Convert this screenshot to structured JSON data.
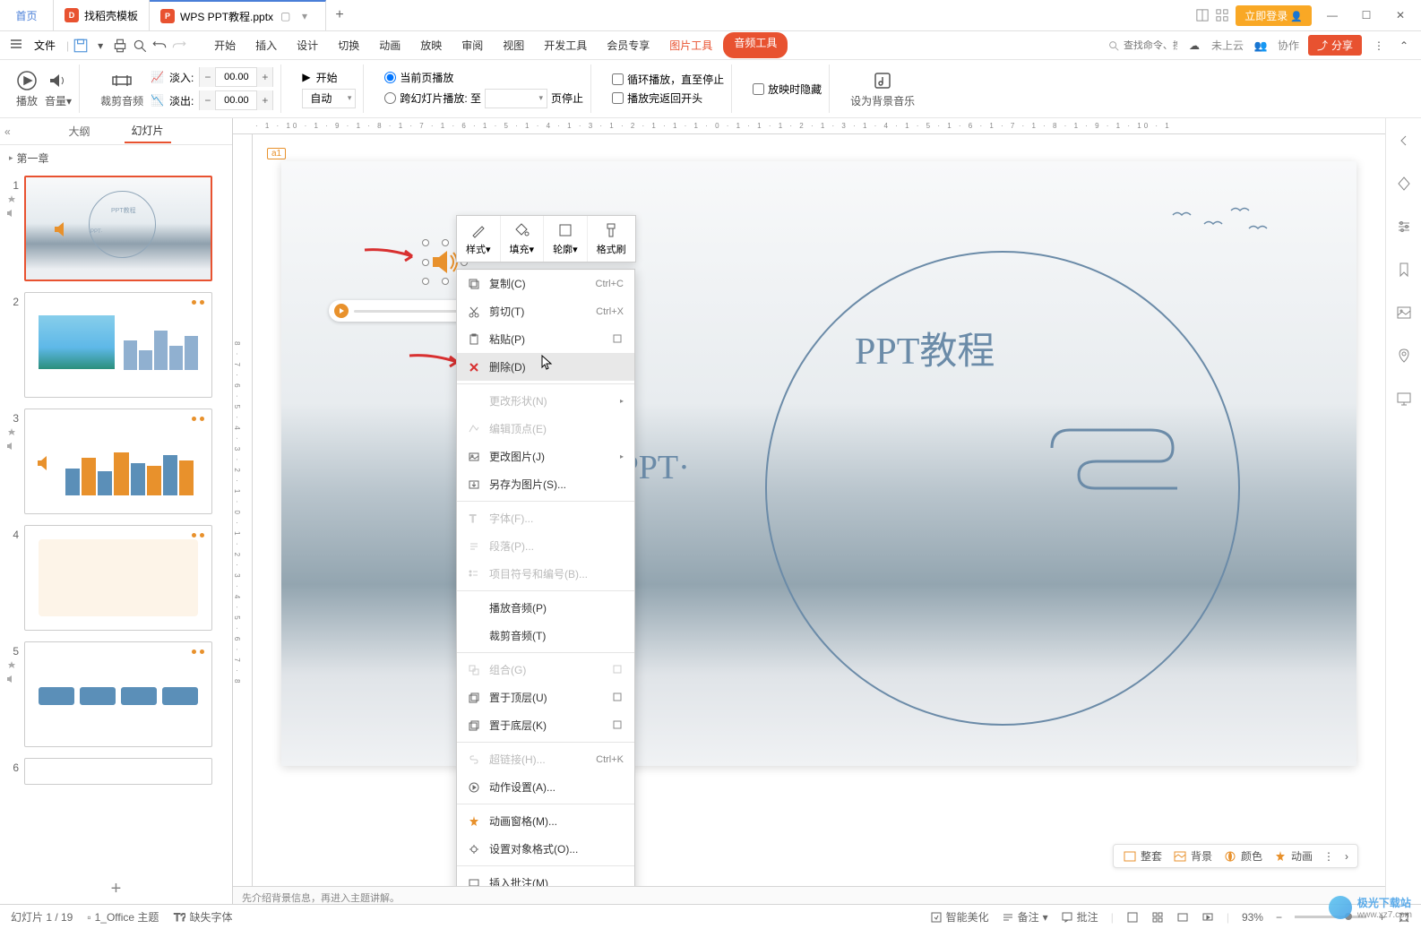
{
  "titlebar": {
    "home": "首页",
    "tab_template": "找稻壳模板",
    "tab_file": "WPS PPT教程.pptx",
    "login": "立即登录"
  },
  "menubar": {
    "file": "文件",
    "tabs": [
      "开始",
      "插入",
      "设计",
      "切换",
      "动画",
      "放映",
      "审阅",
      "视图",
      "开发工具",
      "会员专享"
    ],
    "pic_tool": "图片工具",
    "audio_tool": "音频工具",
    "search_placeholder": "查找命令、搜索模板",
    "cloud": "未上云",
    "coop": "协作",
    "share": "分享"
  },
  "ribbon": {
    "play": "播放",
    "volume": "音量",
    "trim_audio": "裁剪音频",
    "fade_in": "淡入:",
    "fade_out": "淡出:",
    "fade_in_val": "00.00",
    "fade_out_val": "00.00",
    "start": "开始",
    "auto": "自动",
    "current_page": "当前页播放",
    "across_slides": "跨幻灯片播放: 至",
    "page_stop": "页停止",
    "loop_stop": "循环播放，直至停止",
    "return_start": "播放完返回开头",
    "hide_on_play": "放映时隐藏",
    "bg_music": "设为背景音乐"
  },
  "left_panel": {
    "outline": "大纲",
    "slides": "幻灯片",
    "section": "第一章",
    "add": "+"
  },
  "thumbs": [
    {
      "num": "1",
      "title": "PPT教程",
      "sub": "·PPT·"
    },
    {
      "num": "2"
    },
    {
      "num": "3"
    },
    {
      "num": "4"
    },
    {
      "num": "5"
    },
    {
      "num": "6"
    }
  ],
  "slide": {
    "title": "PPT教程",
    "subtitle": "·PPT·",
    "comment1": "a1",
    "comment2": "a1"
  },
  "mini_toolbar": {
    "style": "样式",
    "fill": "填充",
    "outline": "轮廓",
    "format_painter": "格式刷"
  },
  "context_menu": {
    "copy": "复制(C)",
    "copy_sc": "Ctrl+C",
    "cut": "剪切(T)",
    "cut_sc": "Ctrl+X",
    "paste": "粘贴(P)",
    "delete": "删除(D)",
    "change_shape": "更改形状(N)",
    "edit_points": "编辑顶点(E)",
    "change_pic": "更改图片(J)",
    "save_as_pic": "另存为图片(S)...",
    "font": "字体(F)...",
    "paragraph": "段落(P)...",
    "bullets": "项目符号和编号(B)...",
    "play_audio": "播放音频(P)",
    "trim_audio": "裁剪音频(T)",
    "group": "组合(G)",
    "bring_front": "置于顶层(U)",
    "send_back": "置于底层(K)",
    "hyperlink": "超链接(H)...",
    "hyperlink_sc": "Ctrl+K",
    "action": "动作设置(A)...",
    "anim_pane": "动画窗格(M)...",
    "format_obj": "设置对象格式(O)...",
    "insert_comment": "插入批注(M)"
  },
  "float_toolbar": {
    "full_set": "整套",
    "bg": "背景",
    "color": "颜色",
    "anim": "动画"
  },
  "notes": "先介绍背景信息，再进入主题讲解。",
  "statusbar": {
    "slide_pos": "幻灯片 1 / 19",
    "theme": "1_Office 主题",
    "missing_font": "缺失字体",
    "beautify": "智能美化",
    "notes_btn": "备注",
    "comments_btn": "批注",
    "zoom": "93%"
  },
  "watermark": {
    "text": "极光下载站",
    "url": "www.xz7.com"
  }
}
